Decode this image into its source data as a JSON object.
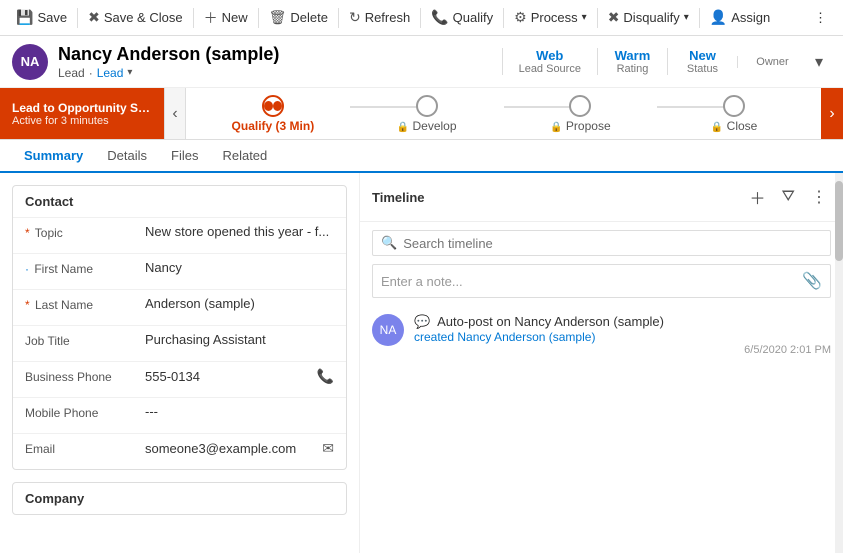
{
  "toolbar": {
    "save_label": "Save",
    "save_close_label": "Save & Close",
    "new_label": "New",
    "delete_label": "Delete",
    "refresh_label": "Refresh",
    "qualify_label": "Qualify",
    "process_label": "Process",
    "disqualify_label": "Disqualify",
    "assign_label": "Assign",
    "more_icon": "⋮"
  },
  "header": {
    "avatar_initials": "NA",
    "name": "Nancy Anderson (sample)",
    "type": "Lead",
    "subtype_label": "Lead",
    "meta": [
      {
        "label": "Lead Source",
        "value": "Web"
      },
      {
        "label": "Rating",
        "value": "Warm"
      },
      {
        "label": "Status",
        "value": "New"
      },
      {
        "label": "Owner",
        "value": ""
      }
    ]
  },
  "process_bar": {
    "promo_title": "Lead to Opportunity Sale...",
    "promo_sub": "Active for 3 minutes",
    "stages": [
      {
        "id": "qualify",
        "label": "Qualify (3 Min)",
        "active": true,
        "locked": false
      },
      {
        "id": "develop",
        "label": "Develop",
        "active": false,
        "locked": true
      },
      {
        "id": "propose",
        "label": "Propose",
        "active": false,
        "locked": true
      },
      {
        "id": "close",
        "label": "Close",
        "active": false,
        "locked": true
      }
    ]
  },
  "tabs": [
    {
      "id": "summary",
      "label": "Summary",
      "active": true
    },
    {
      "id": "details",
      "label": "Details",
      "active": false
    },
    {
      "id": "files",
      "label": "Files",
      "active": false
    },
    {
      "id": "related",
      "label": "Related",
      "active": false
    }
  ],
  "contact": {
    "section_title": "Contact",
    "fields": [
      {
        "label": "Topic",
        "value": "New store opened this year - f...",
        "required": true,
        "icon": ""
      },
      {
        "label": "First Name",
        "value": "Nancy",
        "required": false,
        "optional_marker": "·",
        "icon": ""
      },
      {
        "label": "Last Name",
        "value": "Anderson (sample)",
        "required": true,
        "icon": ""
      },
      {
        "label": "Job Title",
        "value": "Purchasing Assistant",
        "required": false,
        "icon": ""
      },
      {
        "label": "Business Phone",
        "value": "555-0134",
        "required": false,
        "icon": "📞"
      },
      {
        "label": "Mobile Phone",
        "value": "---",
        "required": false,
        "icon": ""
      },
      {
        "label": "Email",
        "value": "someone3@example.com",
        "required": false,
        "icon": "✉"
      }
    ]
  },
  "company": {
    "section_title": "Company"
  },
  "timeline": {
    "title": "Timeline",
    "search_placeholder": "Search timeline",
    "note_placeholder": "Enter a note...",
    "items": [
      {
        "avatar_initials": "NA",
        "post_icon": "💬",
        "title": "Auto-post on Nancy Anderson (sample)",
        "sub_prefix": "created",
        "sub_value": "Nancy Anderson (sample)",
        "date": "6/5/2020 2:01 PM"
      }
    ]
  }
}
